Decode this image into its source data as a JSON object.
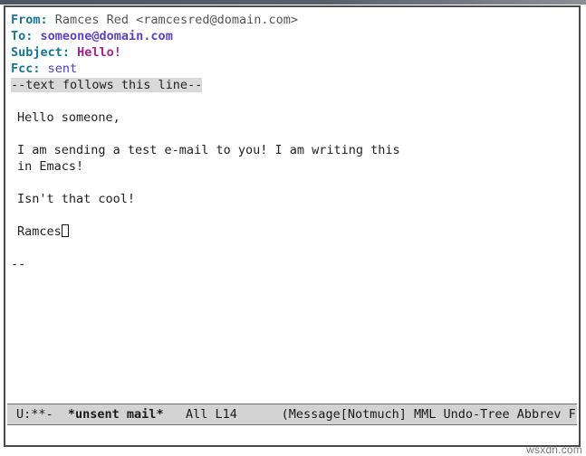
{
  "app": {
    "name": "GNU Emacs",
    "buffer_name": "*unsent mail*"
  },
  "headers": [
    {
      "label": "From:",
      "value": " Ramces Red <ramcesred@domain.com>",
      "value_style": "plain"
    },
    {
      "label": "To:",
      "value": " someone@domain.com",
      "value_style": "to"
    },
    {
      "label": "Subject:",
      "value": " Hello!",
      "value_style": "subject"
    },
    {
      "label": "Fcc:",
      "value": " sent",
      "value_style": "fcc"
    }
  ],
  "separator": "--text follows this line--",
  "body": {
    "line1": "Hello someone,",
    "line2": "",
    "line3": "I am sending a test e-mail to you! I am writing this",
    "line4": "in Emacs!",
    "line5": "",
    "line6": "Isn't that cool!",
    "line7": "",
    "signoff": "Ramces",
    "line9": "",
    "sig_dashes": "--"
  },
  "mode_line": {
    "status_flags": "U:**-",
    "gap1": "  ",
    "buffer": "*unsent mail*",
    "gap2": "   ",
    "position_scroll": "All",
    "gap3": " ",
    "position_line": "L14",
    "gap4": "      ",
    "modes": "(Message[Notmuch] MML Undo-Tree Abbrev Fill)"
  },
  "echo_area": {
    "text": ""
  },
  "watermark": "wsxdn.com",
  "colors": {
    "header_label": "#13759a",
    "header_to_value": "#5c41c8",
    "header_subject_value": "#a0248c",
    "header_fcc_value": "#4b3fc4",
    "header_from_value": "#555555",
    "separator_highlight": "#d9d9d9",
    "mode_line_bg": "#d3d3d3",
    "frame_border": "#4a4a4a",
    "background": "#ffffff",
    "text": "#222222"
  }
}
